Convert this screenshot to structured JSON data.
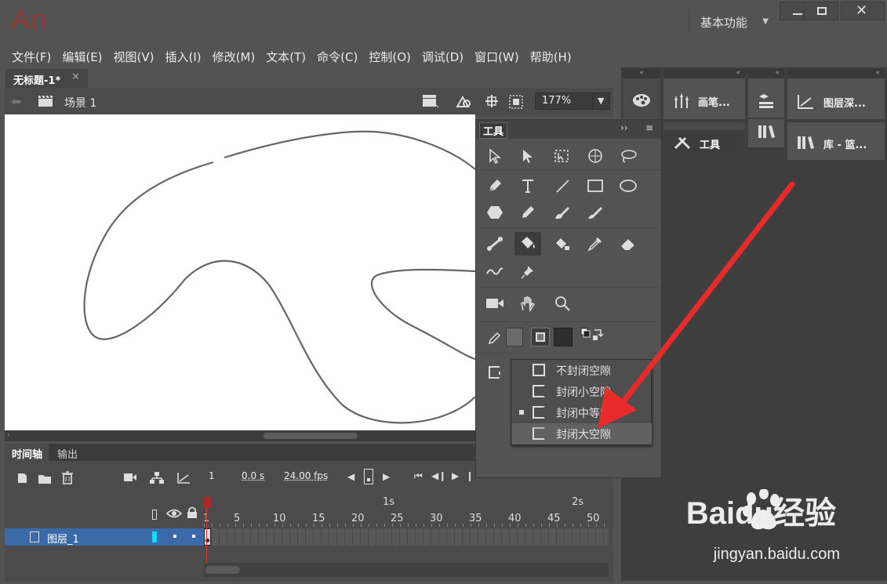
{
  "app": {
    "logo": "An"
  },
  "workspace": {
    "label": "基本功能"
  },
  "menu": [
    "文件(F)",
    "编辑(E)",
    "视图(V)",
    "插入(I)",
    "修改(M)",
    "文本(T)",
    "命令(C)",
    "控制(O)",
    "调试(D)",
    "窗口(W)",
    "帮助(H)"
  ],
  "document": {
    "tab_title": "无标题-1*",
    "scene": "场景 1",
    "zoom": "177%"
  },
  "timeline": {
    "tabs": [
      "时间轴",
      "输出"
    ],
    "frame": "1",
    "time": "0.0 s",
    "fps": "24.00 fps",
    "ruler_seconds": [
      "1s",
      "2s"
    ],
    "ruler_frames": [
      "1",
      "5",
      "10",
      "15",
      "20",
      "25",
      "30",
      "35",
      "40",
      "45",
      "50"
    ],
    "layer_name": "图层_1"
  },
  "panels": {
    "brush": "画笔...",
    "tools": "工具",
    "layer_depth": "图层深...",
    "library": "库 - 篮..."
  },
  "toolbox": {
    "title": "工具"
  },
  "gap_popup": {
    "items": [
      "不封闭空隙",
      "封闭小空隙",
      "封闭中等空隙",
      "封闭大空隙"
    ],
    "selected_index": 2,
    "highlighted_index": 3
  },
  "watermark": {
    "brand": "Baidu经验",
    "url": "jingyan.baidu.com"
  },
  "colors": {
    "arrow": "#e82a2a",
    "layer_highlight": "#3a6aa8",
    "logo": "#8e3b36"
  }
}
